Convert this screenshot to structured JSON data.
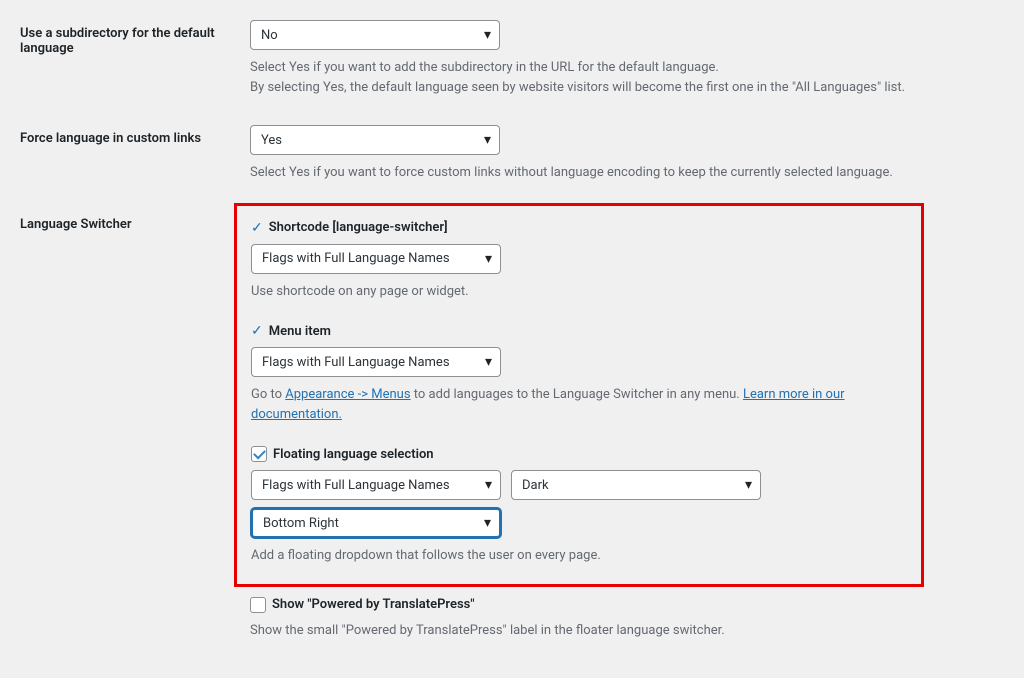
{
  "subdir": {
    "label": "Use a subdirectory for the default language",
    "value": "No",
    "desc1": "Select Yes if you want to add the subdirectory in the URL for the default language.",
    "desc2": "By selecting Yes, the default language seen by website visitors will become the first one in the \"All Languages\" list."
  },
  "force": {
    "label": "Force language in custom links",
    "value": "Yes",
    "desc": "Select Yes if you want to force custom links without language encoding to keep the currently selected language."
  },
  "switcher": {
    "label": "Language Switcher",
    "shortcode": {
      "title": "Shortcode [language-switcher]",
      "value": "Flags with Full Language Names",
      "desc": "Use shortcode on any page or widget."
    },
    "menu": {
      "title": "Menu item",
      "value": "Flags with Full Language Names",
      "desc_prefix": "Go to ",
      "link1": "Appearance -> Menus",
      "desc_mid": " to add languages to the Language Switcher in any menu. ",
      "link2": "Learn more in our documentation."
    },
    "floating": {
      "title": "Floating language selection",
      "style": "Flags with Full Language Names",
      "theme": "Dark",
      "position": "Bottom Right",
      "desc": "Add a floating dropdown that follows the user on every page."
    }
  },
  "powered": {
    "title": "Show \"Powered by TranslatePress\"",
    "desc": "Show the small \"Powered by TranslatePress\" label in the floater language switcher."
  }
}
